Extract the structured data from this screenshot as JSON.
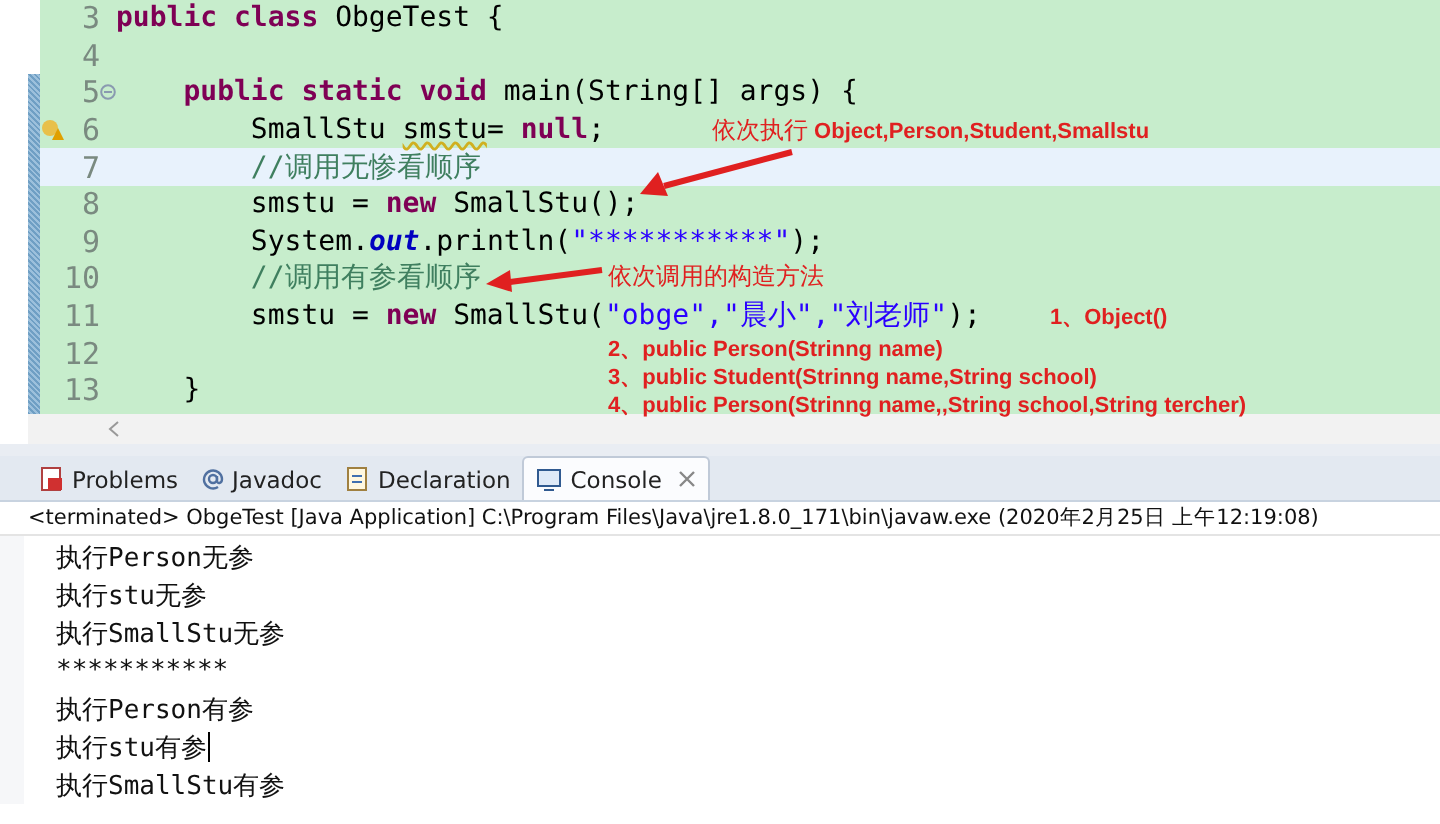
{
  "editor": {
    "lines": [
      {
        "number": "3",
        "highlighted": false,
        "fold": false,
        "warning": false,
        "tokens": [
          {
            "text": "public class ",
            "kind": "keyword"
          },
          {
            "text": "ObgeTest {",
            "kind": "plain"
          }
        ]
      },
      {
        "number": "4",
        "highlighted": false,
        "fold": false,
        "warning": false
      },
      {
        "number": "5",
        "highlighted": false,
        "fold": true,
        "warning": false,
        "tokens": [
          {
            "text": "    public static void ",
            "kind": "keyword"
          },
          {
            "text": "main(String[] args) {",
            "kind": "plain"
          }
        ]
      },
      {
        "number": "6",
        "highlighted": false,
        "fold": false,
        "warning": true,
        "tokens": [
          {
            "text": "        SmallStu ",
            "kind": "plain"
          },
          {
            "text": "smstu",
            "kind": "warned"
          },
          {
            "text": "= ",
            "kind": "plain"
          },
          {
            "text": "null",
            "kind": "keyword"
          },
          {
            "text": ";",
            "kind": "plain"
          }
        ]
      },
      {
        "number": "7",
        "highlighted": true,
        "fold": false,
        "warning": false,
        "tokens": [
          {
            "text": "        //调用无惨看顺序",
            "kind": "comment"
          }
        ]
      },
      {
        "number": "8",
        "highlighted": false,
        "fold": false,
        "warning": false,
        "tokens": [
          {
            "text": "        smstu = ",
            "kind": "plain"
          },
          {
            "text": "new ",
            "kind": "keyword"
          },
          {
            "text": "SmallStu();",
            "kind": "plain"
          }
        ]
      },
      {
        "number": "9",
        "highlighted": false,
        "fold": false,
        "warning": false,
        "tokens": [
          {
            "text": "        System.",
            "kind": "plain"
          },
          {
            "text": "out",
            "kind": "field"
          },
          {
            "text": ".println(",
            "kind": "plain"
          },
          {
            "text": "\"***********\"",
            "kind": "string"
          },
          {
            "text": ");",
            "kind": "plain"
          }
        ]
      },
      {
        "number": "10",
        "highlighted": false,
        "fold": false,
        "warning": false,
        "tokens": [
          {
            "text": "        //调用有参看顺序",
            "kind": "comment"
          }
        ]
      },
      {
        "number": "11",
        "highlighted": false,
        "fold": false,
        "warning": false,
        "tokens": [
          {
            "text": "        smstu = ",
            "kind": "plain"
          },
          {
            "text": "new ",
            "kind": "keyword"
          },
          {
            "text": "SmallStu(",
            "kind": "plain"
          },
          {
            "text": "\"obge\",\"晨小\",\"刘老师\"",
            "kind": "string"
          },
          {
            "text": ");",
            "kind": "plain"
          }
        ]
      },
      {
        "number": "12",
        "highlighted": false,
        "fold": false,
        "warning": false
      },
      {
        "number": "13",
        "highlighted": false,
        "fold": false,
        "warning": false,
        "tokens": [
          {
            "text": "    }",
            "kind": "plain"
          }
        ]
      }
    ]
  },
  "annotations": {
    "order_note": {
      "label": "依次执行",
      "detail": "Object,Person,Student,Smallstu"
    },
    "constructors_title": "依次调用的构造方法",
    "constructors": [
      "1、Object()",
      "2、public Person(Strinng name)",
      "3、public Student(Strinng name,String school)",
      "4、public Person(Strinng name,,String school,String tercher)"
    ]
  },
  "tabs": [
    {
      "label": "Problems",
      "selected": false
    },
    {
      "label": "Javadoc",
      "selected": false
    },
    {
      "label": "Declaration",
      "selected": false
    },
    {
      "label": "Console",
      "selected": true
    }
  ],
  "console": {
    "status": "<terminated> ObgeTest [Java Application] C:\\Program Files\\Java\\jre1.8.0_171\\bin\\javaw.exe (2020年2月25日 上午12:19:08)",
    "output": [
      "执行Person无参",
      "执行stu无参",
      "执行SmallStu无参",
      "***********",
      "执行Person有参",
      "执行stu有参",
      "执行SmallStu有参"
    ]
  }
}
